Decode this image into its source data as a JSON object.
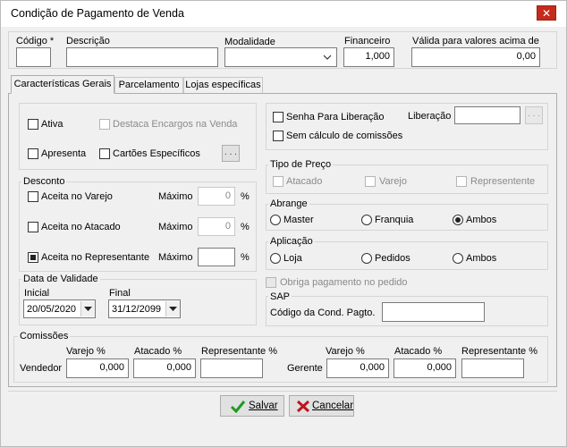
{
  "window": {
    "title": "Condição de Pagamento de Venda",
    "close_glyph": "✕"
  },
  "header": {
    "codigo_label": "Código *",
    "descricao_label": "Descrição",
    "modalidade_label": "Modalidade",
    "financeiro_label": "Financeiro",
    "financeiro_value": "1,000",
    "valida_label": "Válida para valores acima de",
    "valida_value": "0,00",
    "codigo_value": "",
    "descricao_value": "",
    "modalidade_value": ""
  },
  "tabs": [
    {
      "label": "Características Gerais",
      "active": true
    },
    {
      "label": "Parcelamento",
      "active": false
    },
    {
      "label": "Lojas específicas",
      "active": false
    }
  ],
  "flags": {
    "ativa": "Ativa",
    "destaca": "Destaca  Encargos na Venda",
    "apresenta": "Apresenta",
    "cartoes": "Cartões Específicos",
    "ellipsis": ". . ."
  },
  "liberacao": {
    "senha": "Senha Para Liberação",
    "sem_calculo": "Sem cálculo de comissões",
    "label": "Liberação",
    "value": ""
  },
  "desconto": {
    "title": "Desconto",
    "maximo_label": "Máximo",
    "pct": "%",
    "rows": [
      {
        "label": "Aceita no Varejo",
        "value": "0",
        "checked": false
      },
      {
        "label": "Aceita no Atacado",
        "value": "0",
        "checked": false
      },
      {
        "label": "Aceita no Representante",
        "value": "",
        "checked": true
      }
    ]
  },
  "tipo_preco": {
    "title": "Tipo de Preço",
    "options": [
      "Atacado",
      "Varejo",
      "Representente"
    ]
  },
  "abrange": {
    "title": "Abrange",
    "options": [
      "Master",
      "Franquia",
      "Ambos"
    ],
    "selected": "Ambos"
  },
  "aplicacao": {
    "title": "Aplicação",
    "options": [
      "Loja",
      "Pedidos",
      "Ambos"
    ],
    "selected": ""
  },
  "validade": {
    "title": "Data de Validade",
    "inicial_label": "Inicial",
    "inicial_value": "20/05/2020",
    "final_label": "Final",
    "final_value": "31/12/2099"
  },
  "obriga": "Obriga pagamento no pedido",
  "sap": {
    "title": "SAP",
    "codigo_label": "Código da Cond. Pagto.",
    "codigo_value": ""
  },
  "comissoes": {
    "title": "Comissões",
    "varejo": "Varejo %",
    "atacado": "Atacado %",
    "representante": "Representante %",
    "vendedor_label": "Vendedor",
    "vendedor_varejo": "0,000",
    "vendedor_atacado": "0,000",
    "vendedor_representante": "",
    "gerente_label": "Gerente",
    "gerente_varejo": "0,000",
    "gerente_atacado": "0,000",
    "gerente_representante": ""
  },
  "buttons": {
    "salvar": "Salvar",
    "cancelar": "Cancelar"
  },
  "colors": {
    "close": "#c42b1c",
    "check_green": "#1e9b1e",
    "cancel_red": "#c0141e"
  }
}
